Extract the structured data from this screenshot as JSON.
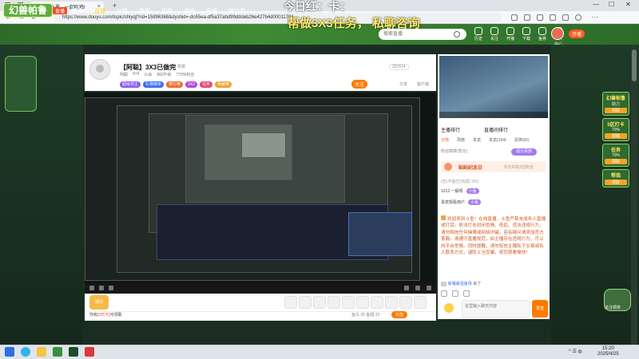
{
  "browser": {
    "tab_title": "鲨鱼十里、一起吃鸡!",
    "address": "https://www.douyu.com/topic/shiyqj?rid=15896368&dyshid=-dc65ea-df5a37abd99dddeb26e427b4d00011701"
  },
  "overlay": {
    "line1": "今日红：卡：",
    "line2": "帮做3X3任务，   私聊咨询"
  },
  "header": {
    "logo": "幻兽帕鲁",
    "live_tag": "直播",
    "nav": [
      "首页",
      "直播",
      "分类",
      "赛事",
      "视频",
      "游戏",
      "鱼吧",
      "粉丝节"
    ],
    "search_placeholder": "搜索直播",
    "icons": [
      "历史",
      "关注",
      "开播",
      "下载",
      "鱼券",
      "个人中心"
    ],
    "upload": "开播"
  },
  "room": {
    "title": "【阿聪】3X3已做完",
    "report": "举报",
    "meta": [
      "阿聪",
      "474",
      "公会",
      "MG升级",
      "779%粉丝"
    ],
    "badges": [
      "超级领主",
      "礼物榜单",
      "排行榜",
      "3X3",
      "任务",
      "贡献榜"
    ],
    "room_id": "207574",
    "follow": "关注",
    "share": "分享",
    "report2": "客户端"
  },
  "gift": {
    "fun_label": "娱乐",
    "notice_prefix": "你有",
    "notice_item": "[3日卡]",
    "notice_suffix": "可领取",
    "fish": "鱼丸 25   鱼翅 33",
    "recharge": "充值"
  },
  "chat": {
    "tabs1": [
      "主播排行",
      "直播间排行"
    ],
    "tabs2": [
      "日榜",
      "周榜",
      "贵宾",
      "贵宾(294)",
      "贵族(65)"
    ],
    "fans_text": "粉丝徽章(暂无)",
    "vip_btn": "成为贵族",
    "club_title": "贴贴纪念日",
    "club_sub": "今日共有2位粉丝",
    "rank1": "(无)不能(已完成) 3X3",
    "users": [
      {
        "name": "1212 一般呀",
        "tag": "小兔"
      },
      {
        "name": "贵宾观看用户",
        "tag": "小兔"
      }
    ],
    "system_message": "欢迎来到斗鱼！在线直播，斗鱼严禁未成年人直播或打赏。依法打击封闭色情、低俗、违法违规行为，请勿相信任何赌博或网络诈骗，若有疑问请添加官方客服。请遵守直播规范，如主播存在违规行为，可以向平台举报。同时提醒，请勿轻信主播私下交易或私人联系方式，谨防上当受骗，祝您观看愉快！",
    "new_msg_level": "1",
    "new_msg_name": "斩獲最强鱼场",
    "new_msg_text": "来了",
    "input_placeholder": "这里输入聊天内容",
    "send": "发送"
  },
  "promo": [
    {
      "title": "幻兽帕鲁",
      "value": "助力",
      "btn": "领取"
    },
    {
      "title": "5区打卡",
      "value": "70%",
      "btn": "领取"
    },
    {
      "title": "任务",
      "value": "70%",
      "btn": "领取"
    },
    {
      "title": "帮我",
      "value": "",
      "btn": "领取"
    }
  ],
  "mascot_label": "关注领奖",
  "taskbar": {
    "time": "15:20",
    "date": "2025/4/25"
  }
}
